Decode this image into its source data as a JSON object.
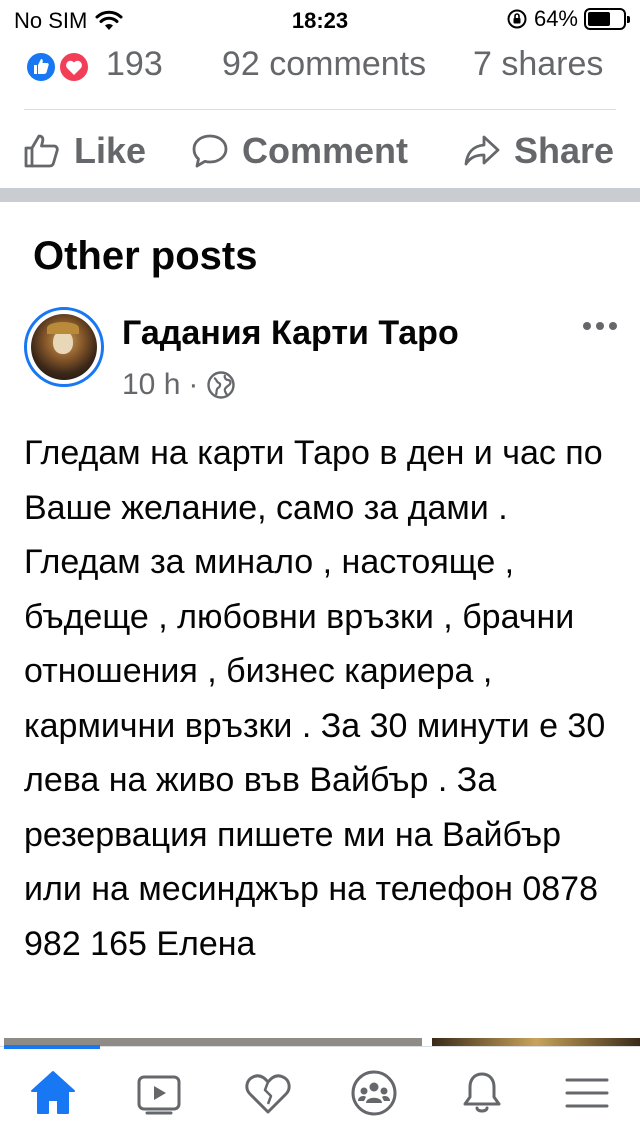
{
  "status_bar": {
    "carrier": "No SIM",
    "time": "18:23",
    "battery_percent": "64%",
    "battery_level": 0.64,
    "icons": [
      "wifi-icon",
      "orientation-lock-icon",
      "battery-icon"
    ]
  },
  "post_stats": {
    "reactions_count": "193",
    "reaction_icons": [
      "like-reaction-icon",
      "love-reaction-icon"
    ],
    "comments": "92 comments",
    "shares": "7 shares"
  },
  "actions": {
    "like_label": "Like",
    "comment_label": "Comment",
    "share_label": "Share"
  },
  "other_posts": {
    "section_title": "Other posts",
    "post": {
      "page_name": "Гадания Карти Таро",
      "time_ago": "10 h",
      "separator": "·",
      "audience_icon": "globe-icon",
      "more_icon": "more-dots-icon",
      "text": "Гледам на карти Таро в ден и час по Ваше желание, само за дами . Гледам за минало , настояще , бъдеще , любовни връзки , брачни отношения , бизнес кариера , кармични връзки . За 30 минути е 30 лева на живо във Вайбър . За резервация пишете ми на Вайбър или на месинджър на телефон 0878 982 165 Елена"
    }
  },
  "tab_bar": {
    "active": "home",
    "tabs": [
      "home-icon",
      "video-icon",
      "dating-icon",
      "groups-icon",
      "notifications-icon",
      "menu-icon"
    ]
  },
  "colors": {
    "accent": "#1877f2",
    "secondary_text": "#65676b",
    "primary_text": "#050505",
    "divider": "#c9ccd1",
    "love": "#f33e58"
  }
}
